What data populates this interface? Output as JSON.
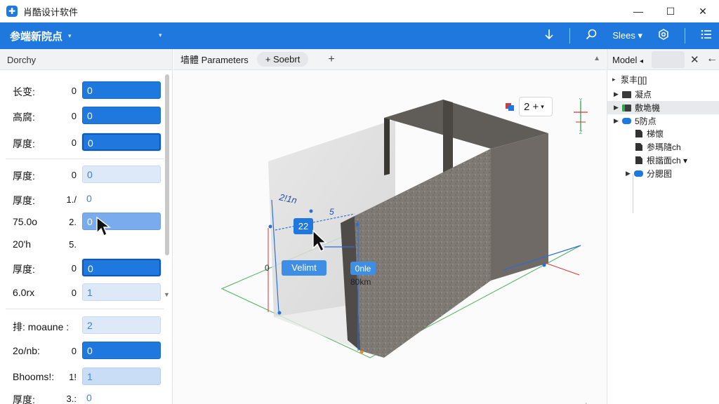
{
  "window": {
    "title": "肖酷设计软件",
    "logo_glyph": "✚",
    "controls": {
      "minimize": "—",
      "maximize": "☐",
      "close": "✕"
    }
  },
  "toolbar": {
    "project": "参端新院点",
    "caret": "▾",
    "right_icons": [
      "arrow-down-icon",
      "search-icon",
      "settings-icon",
      "list-icon"
    ],
    "sizes_label": "Slees ▾",
    "accent": "#1f78dd"
  },
  "left_panel": {
    "title": "Dorchy",
    "rows": [
      {
        "label": "长变:",
        "value": "0",
        "field": "0"
      },
      {
        "label": "高腐:",
        "value": "0",
        "field": "0"
      },
      {
        "label": "厚度:",
        "value": "0",
        "field": "0"
      },
      {
        "label": "厚度:",
        "value": "0",
        "field": "0"
      },
      {
        "label": "厚度:",
        "value": "1./",
        "field": "0"
      },
      {
        "label": "75.0o",
        "value": "2.",
        "field": "0"
      },
      {
        "label": "20'h",
        "value": "5.",
        "field": ""
      },
      {
        "label": "厚度:",
        "value": "0",
        "field": "0"
      },
      {
        "label": "6.0rx",
        "value": "0",
        "field": "1"
      },
      {
        "label": "排: moaune :",
        "value": "",
        "field": "2"
      },
      {
        "label": "2o/nb:",
        "value": "0",
        "field": "0"
      },
      {
        "label": "Bhooms!:",
        "value": "1!",
        "field": "1"
      },
      {
        "label": "厚度:",
        "value": "3.:",
        "field": "0"
      }
    ]
  },
  "viewport": {
    "tab_active": "墙體 Parameters",
    "tab_secondary": "+ Soebrt",
    "tab_add": "+",
    "zoom_value": "2 +",
    "zoom_caret": "▾",
    "dimension_top": "2!1n",
    "dimension_top_right": "5",
    "badge_value": "22",
    "label_left": "Velimt",
    "label_right": "0nle",
    "label_unit": "80km",
    "label_zero": "0",
    "gizmo_axis_top": "Y",
    "gizmo_axis_bottom": "Z",
    "bottom_arrow": "↓"
  },
  "right_panel": {
    "title": "Model",
    "title_caret": "◂",
    "tree": [
      {
        "label": "泵丰[][]",
        "level": 0,
        "icon": "collapse",
        "expanded": true
      },
      {
        "label": "凝点",
        "level": 1,
        "icon": "folder-dark",
        "expanded": false
      },
      {
        "label": "敷垝機",
        "level": 1,
        "icon": "folder-green",
        "expanded": false,
        "selected": true
      },
      {
        "label": "5防点",
        "level": 1,
        "icon": "folder-blue",
        "expanded": true
      },
      {
        "label": "梯懷",
        "level": 2,
        "icon": "doc"
      },
      {
        "label": "参瑪隨ch",
        "level": 2,
        "icon": "doc"
      },
      {
        "label": "根諧面ch ▾",
        "level": 2,
        "icon": "doc"
      },
      {
        "label": "分腮图",
        "level": 2,
        "icon": "folder-blue"
      }
    ]
  }
}
